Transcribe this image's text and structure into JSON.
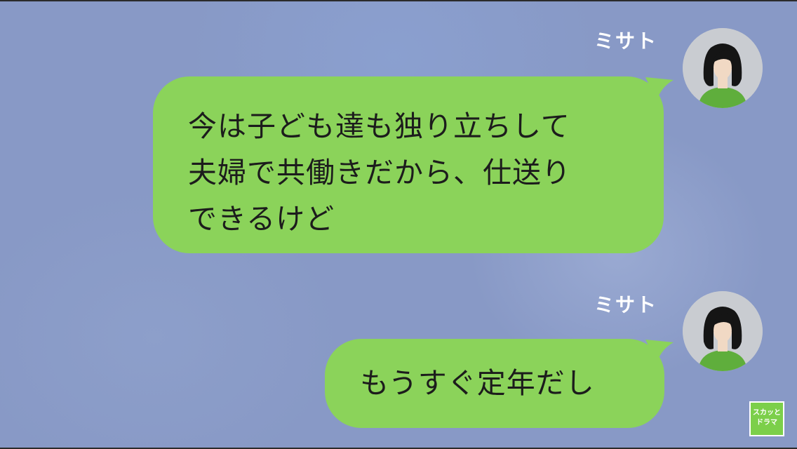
{
  "colors": {
    "background": "#8899c6",
    "bubble": "#8bd35a",
    "bubble_text": "#1c1c1c",
    "name_text": "#ffffff",
    "avatar_bg": "#c9ccd1",
    "avatar_shirt": "#5fae3c",
    "avatar_hair": "#151515"
  },
  "messages": [
    {
      "sender": "ミサト",
      "avatar_icon": "woman-avatar-icon",
      "lines": [
        "今は子ども達も独り立ちして",
        "夫婦で共働きだから、仕送り",
        "できるけど"
      ]
    },
    {
      "sender": "ミサト",
      "avatar_icon": "woman-avatar-icon",
      "lines": [
        "もうすぐ定年だし"
      ]
    }
  ],
  "watermark": {
    "line1": "スカッと",
    "line2": "ドラマ"
  }
}
